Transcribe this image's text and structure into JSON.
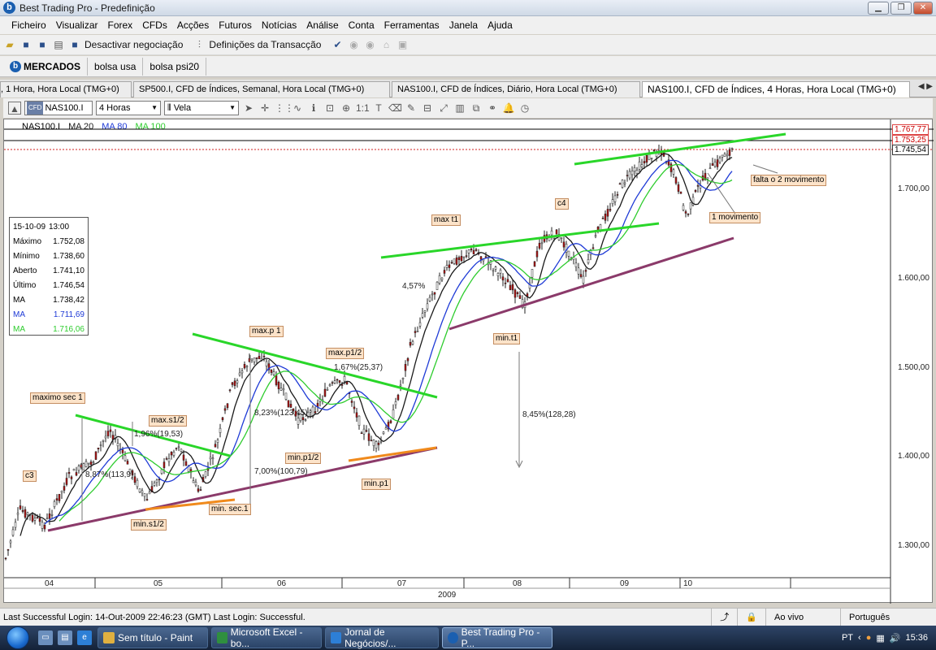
{
  "window": {
    "title": "Best Trading Pro - Predefinição",
    "logo_letter": "b"
  },
  "menu": [
    "Ficheiro",
    "Visualizar",
    "Forex",
    "CFDs",
    "Acções",
    "Futuros",
    "Notícias",
    "Análise",
    "Conta",
    "Ferramentas",
    "Janela",
    "Ajuda"
  ],
  "toolbar": {
    "deactivate_label": "Desactivar negociação",
    "transaction_label": "Definições da Transacção"
  },
  "workspaces": {
    "mercados": "MERCADOS",
    "bolsa_usa": "bolsa usa",
    "bolsa_psi": "bolsa psi20"
  },
  "chart_tabs": [
    ", 1 Hora, Hora Local (TMG+0)",
    "SP500.I, CFD de Índices, Semanal, Hora Local (TMG+0)",
    "NAS100.I, CFD de Índices, Diário, Hora Local (TMG+0)",
    "NAS100.I, CFD de Índices, 4 Horas, Hora Local (TMG+0)"
  ],
  "chart_toolbar": {
    "symbol": "NAS100.I",
    "symbol_badge": "CFD",
    "timeframe": "4 Horas",
    "chart_type": "Vela"
  },
  "legend": {
    "symbol": "NAS100.I",
    "ma20": "MA 20",
    "ma80": "MA 80",
    "ma100": "MA 100"
  },
  "colors": {
    "ma20": "#1a1a1a",
    "ma80": "#1e3ad6",
    "ma100": "#2ecc2e",
    "trend_green": "#29d629",
    "trend_purple": "#8b3a6a",
    "trend_orange": "#f08a1c",
    "price_line": "#d02020"
  },
  "info": [
    [
      "15-10-09",
      "13:00"
    ],
    [
      "Máximo",
      "1.752,08"
    ],
    [
      "Mínimo",
      "1.738,60"
    ],
    [
      "Aberto",
      "1.741,10"
    ],
    [
      "Último",
      "1.746,54"
    ],
    [
      "MA",
      "1.738,42"
    ],
    [
      "MA",
      "1.711,69"
    ],
    [
      "MA",
      "1.716,06"
    ]
  ],
  "annotations": {
    "maximo_sec1": "maximo sec 1",
    "max_s1_2": "max.s1/2",
    "min_s1_2": "min.s1/2",
    "min_sec1": "min. sec.1",
    "max_p1": "max.p 1",
    "max_p1_2": "max.p1/2",
    "min_p1_2": "min.p1/2",
    "min_p1": "min.p1",
    "max_t1": "max t1",
    "min_t1": "min.t1",
    "c3": "c3",
    "c4": "c4",
    "falta": "falta o 2 movimento",
    "mov1": "1 movimento"
  },
  "percentages": {
    "p1": "1,96%(19,53)",
    "p2": "8,87%(113,9)",
    "p3": "8,23%(123,45)",
    "p4": "7,00%(100,79)",
    "p5": "1,67%(25,37)",
    "p6": "4,57%",
    "p7": "8,45%(128,28)"
  },
  "y_axis": [
    "1.700,00",
    "1.600,00",
    "1.500,00",
    "1.400,00",
    "1.300,00"
  ],
  "price_tags": [
    "1.767,77",
    "1.753,25",
    "1.745,54"
  ],
  "x_axis": [
    "04",
    "05",
    "06",
    "07",
    "08",
    "09",
    "10"
  ],
  "year_label": "2009",
  "status": {
    "text": "Last Successful Login: 14-Out-2009 22:46:23 (GMT)  Last Login: Successful.",
    "live": "Ao vivo",
    "language": "Português"
  },
  "taskbar": {
    "items": [
      "Sem título - Paint",
      "Microsoft Excel - bo...",
      "Jornal de Negócios/...",
      "Best Trading Pro - P..."
    ],
    "lang": "PT",
    "clock": "15:36"
  }
}
